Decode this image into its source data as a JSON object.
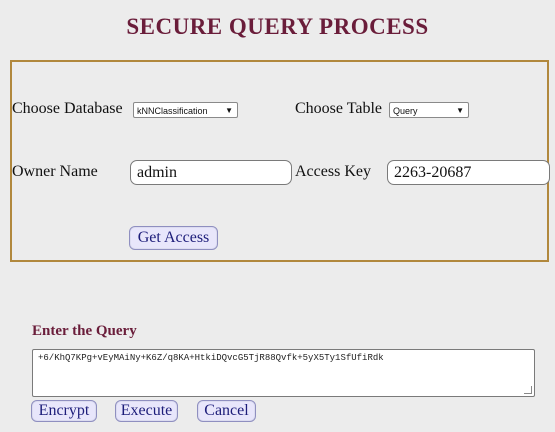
{
  "page": {
    "title": "SECURE QUERY PROCESS"
  },
  "access_form": {
    "choose_database_label": "Choose Database",
    "database_selected": "kNNClassification",
    "choose_table_label": "Choose Table",
    "table_selected": "Query",
    "owner_name_label": "Owner Name",
    "owner_name_value": "admin",
    "access_key_label": "Access Key",
    "access_key_value": "2263-20687",
    "get_access_label": "Get Access"
  },
  "query": {
    "label": "Enter the Query",
    "value": "+6/KhQ7KPg+vEyMAiNy+K6Z/q8KA+HtkiDQvcG5TjR88Qvfk+5yX5Ty1SfUfiRdk"
  },
  "actions": {
    "encrypt_label": "Encrypt",
    "execute_label": "Execute",
    "cancel_label": "Cancel"
  },
  "icons": {
    "dropdown_caret": "▼"
  },
  "colors": {
    "background": "#ececec",
    "title": "#6a1d3a",
    "panel_border": "#b1883d",
    "button_bg": "#e8e6fb",
    "button_text": "#1d1d7a"
  }
}
